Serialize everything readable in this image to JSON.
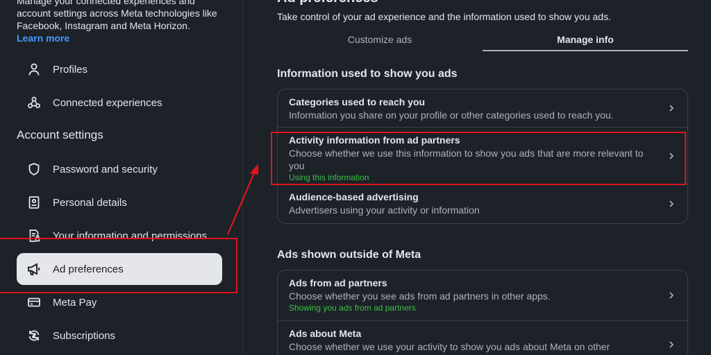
{
  "sidebar": {
    "intro": {
      "text": "Manage your connected experiences and account settings across Meta technologies like Facebook, Instagram and Meta Horizon.",
      "learn_more": "Learn more"
    },
    "top_items": [
      {
        "label": "Profiles",
        "icon": "person-icon"
      },
      {
        "label": "Connected experiences",
        "icon": "connected-icon"
      }
    ],
    "section_title": "Account settings",
    "items": [
      {
        "label": "Password and security",
        "icon": "shield-icon"
      },
      {
        "label": "Personal details",
        "icon": "id-card-icon"
      },
      {
        "label": "Your information and permissions",
        "icon": "document-lock-icon"
      },
      {
        "label": "Ad preferences",
        "icon": "megaphone-icon",
        "active": true
      },
      {
        "label": "Meta Pay",
        "icon": "card-icon"
      },
      {
        "label": "Subscriptions",
        "icon": "subscriptions-icon"
      }
    ]
  },
  "main": {
    "title": "Ad preferences",
    "subtitle": "Take control of your ad experience and the information used to show you ads.",
    "tabs": [
      {
        "label": "Customize ads",
        "active": false
      },
      {
        "label": "Manage info",
        "active": true
      }
    ],
    "groups": [
      {
        "title": "Information used to show you ads",
        "rows": [
          {
            "title": "Categories used to reach you",
            "desc": "Information you share on your profile or other categories used to reach you.",
            "status": ""
          },
          {
            "title": "Activity information from ad partners",
            "desc": "Choose whether we use this information to show you ads that are more relevant to you",
            "status": "Using this information"
          },
          {
            "title": "Audience-based advertising",
            "desc": "Advertisers using your activity or information",
            "status": ""
          }
        ]
      },
      {
        "title": "Ads shown outside of Meta",
        "rows": [
          {
            "title": "Ads from ad partners",
            "desc": "Choose whether you see ads from ad partners in other apps.",
            "status": "Showing you ads from ad partners"
          },
          {
            "title": "Ads about Meta",
            "desc": "Choose whether we use your activity to show you ads about Meta on other",
            "status": ""
          }
        ]
      }
    ]
  },
  "colors": {
    "background": "#1c2228",
    "highlight": "#e0141e",
    "status_green": "#3fbf4a",
    "link_blue": "#4599ff"
  }
}
